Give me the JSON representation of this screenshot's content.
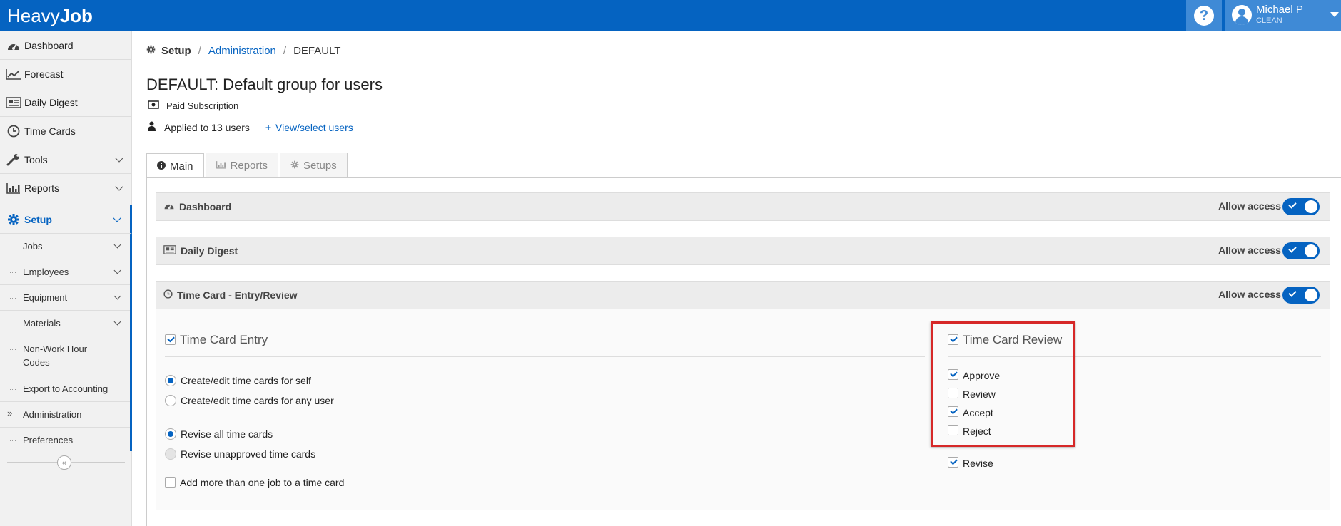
{
  "header": {
    "logo_light": "Heavy",
    "logo_bold": "Job",
    "help_glyph": "?",
    "user_name": "Michael P",
    "user_company": "CLEAN",
    "brand_color": "#0563c1"
  },
  "sidebar": {
    "items": [
      {
        "label": "Dashboard",
        "icon": "dashboard-icon"
      },
      {
        "label": "Forecast",
        "icon": "chart-line-icon"
      },
      {
        "label": "Daily Digest",
        "icon": "newspaper-icon"
      },
      {
        "label": "Time Cards",
        "icon": "clock-icon"
      },
      {
        "label": "Tools",
        "icon": "wrench-icon"
      },
      {
        "label": "Reports",
        "icon": "bar-chart-icon"
      },
      {
        "label": "Setup",
        "icon": "gear-icon"
      }
    ],
    "setup_children": [
      {
        "label": "Jobs"
      },
      {
        "label": "Employees"
      },
      {
        "label": "Equipment"
      },
      {
        "label": "Materials"
      },
      {
        "label_line1": "Non-Work Hour",
        "label_line2": "Codes"
      },
      {
        "label": "Export to Accounting"
      },
      {
        "label": "Administration",
        "marker": "»"
      },
      {
        "label": "Preferences"
      }
    ],
    "collapse_glyph": "«"
  },
  "breadcrumb": {
    "root": "Setup",
    "link": "Administration",
    "current": "DEFAULT",
    "separator": "/"
  },
  "page": {
    "title": "DEFAULT: Default group for users",
    "subscription": "Paid Subscription",
    "applied": "Applied to 13 users",
    "view_users": "View/select users"
  },
  "tabs": [
    {
      "label": "Main",
      "icon": "info-icon"
    },
    {
      "label": "Reports",
      "icon": "bar-chart-icon"
    },
    {
      "label": "Setups",
      "icon": "gear-icon"
    }
  ],
  "sections": [
    {
      "title": "Dashboard",
      "allow_label": "Allow access",
      "enabled": true
    },
    {
      "title": "Daily Digest",
      "allow_label": "Allow access",
      "enabled": true
    },
    {
      "title": "Time Card - Entry/Review",
      "allow_label": "Allow access",
      "enabled": true
    }
  ],
  "time_card": {
    "entry_label": "Time Card Entry",
    "entry_checked": true,
    "create_self": "Create/edit time cards for self",
    "create_any": "Create/edit time cards for any user",
    "revise_all": "Revise all time cards",
    "revise_unapproved": "Revise unapproved time cards",
    "add_more_jobs": "Add more than one job to a time card",
    "review_label": "Time Card Review",
    "review_checked": true,
    "approve": "Approve",
    "review": "Review",
    "accept": "Accept",
    "reject": "Reject",
    "revise": "Revise",
    "highlight_color": "#d62828"
  }
}
